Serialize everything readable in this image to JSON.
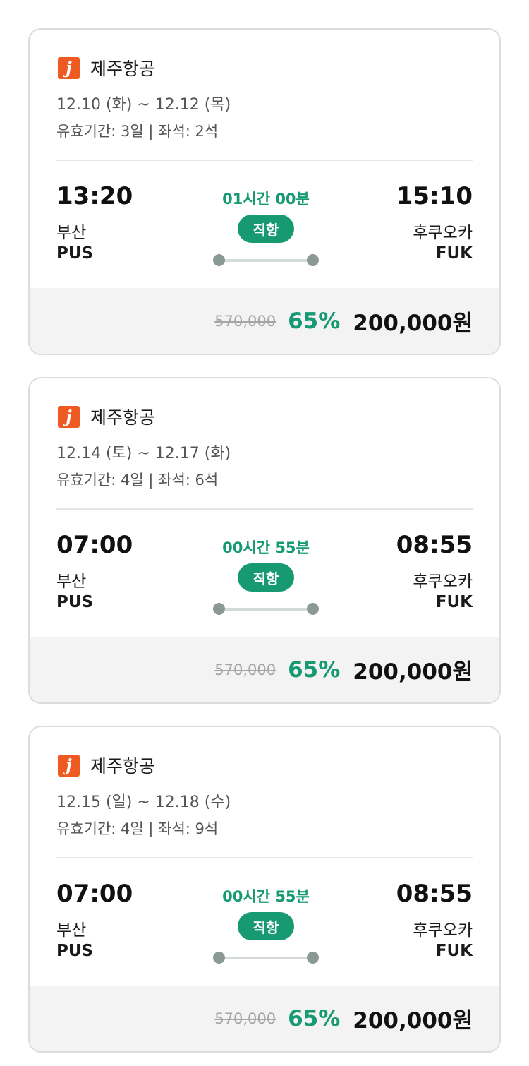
{
  "colors": {
    "accent_green": "#179a72",
    "logo_orange": "#ef5a22",
    "card_border": "#dcdcdc",
    "price_bar_bg": "#f3f3f3"
  },
  "flights": [
    {
      "airline": "제주항공",
      "logo_glyph": "j",
      "logo_icon": "jeju-air-logo",
      "dates": "12.10 (화) ~ 12.12 (목)",
      "validity": "유효기간: 3일 | 좌석: 2석",
      "depart_time": "13:20",
      "depart_city": "부산",
      "depart_code": "PUS",
      "arrive_time": "15:10",
      "arrive_city": "후쿠오카",
      "arrive_code": "FUK",
      "duration": "01시간 00분",
      "flight_type": "직항",
      "original_price": "570,000",
      "discount": "65%",
      "price": "200,000원"
    },
    {
      "airline": "제주항공",
      "logo_glyph": "j",
      "logo_icon": "jeju-air-logo",
      "dates": "12.14 (토) ~ 12.17 (화)",
      "validity": "유효기간: 4일 | 좌석: 6석",
      "depart_time": "07:00",
      "depart_city": "부산",
      "depart_code": "PUS",
      "arrive_time": "08:55",
      "arrive_city": "후쿠오카",
      "arrive_code": "FUK",
      "duration": "00시간 55분",
      "flight_type": "직항",
      "original_price": "570,000",
      "discount": "65%",
      "price": "200,000원"
    },
    {
      "airline": "제주항공",
      "logo_glyph": "j",
      "logo_icon": "jeju-air-logo",
      "dates": "12.15 (일) ~ 12.18 (수)",
      "validity": "유효기간: 4일 | 좌석: 9석",
      "depart_time": "07:00",
      "depart_city": "부산",
      "depart_code": "PUS",
      "arrive_time": "08:55",
      "arrive_city": "후쿠오카",
      "arrive_code": "FUK",
      "duration": "00시간 55분",
      "flight_type": "직항",
      "original_price": "570,000",
      "discount": "65%",
      "price": "200,000원"
    }
  ]
}
